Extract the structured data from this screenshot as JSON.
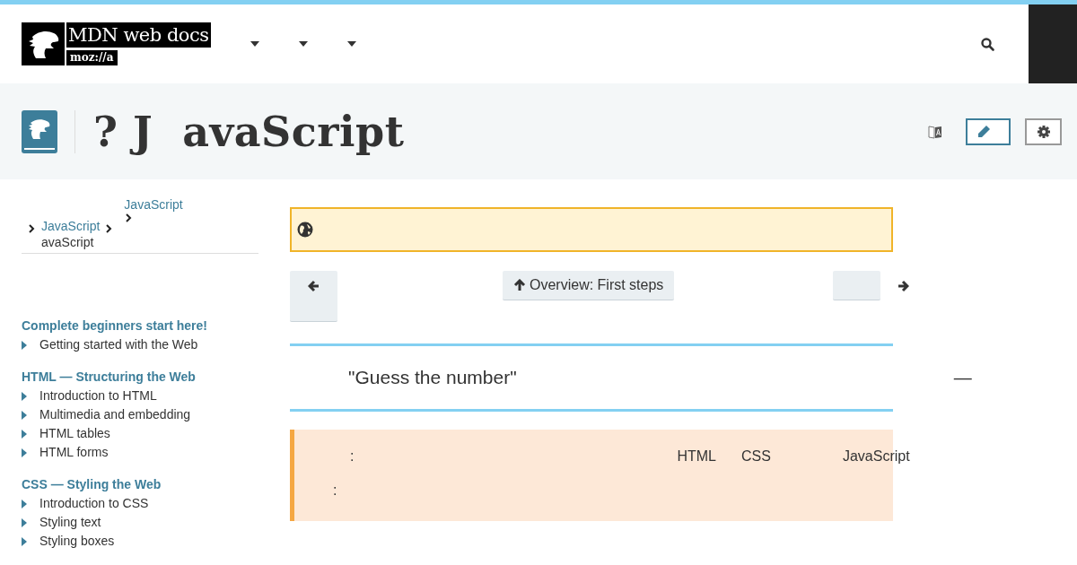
{
  "header": {
    "logo_text": "MDN web docs",
    "logo_sub": "moz://a"
  },
  "title": "? J  avaScript",
  "breadcrumbs": [
    {
      "text": "JavaScript",
      "kind": "link"
    },
    {
      "text": "JavaScript",
      "kind": "link"
    },
    {
      "text": "avaScript",
      "kind": "current"
    }
  ],
  "sidebar": {
    "sections": [
      {
        "heading": "Complete beginners start here!",
        "items": [
          "Getting started with the Web"
        ]
      },
      {
        "heading": "HTML — Structuring the Web",
        "items": [
          "Introduction to HTML",
          "Multimedia and embedding",
          "HTML tables",
          "HTML forms"
        ]
      },
      {
        "heading": "CSS — Styling the Web",
        "items": [
          "Introduction to CSS",
          "Styling text",
          "Styling boxes"
        ]
      }
    ]
  },
  "pager": {
    "up_label": "Overview: First steps"
  },
  "section": {
    "heading": "\"Guess the number\"",
    "dash": "—"
  },
  "prerequisites": {
    "row_1": [
      ":",
      "HTML",
      "CSS",
      "JavaScript"
    ],
    "row_2": [
      ":"
    ]
  }
}
